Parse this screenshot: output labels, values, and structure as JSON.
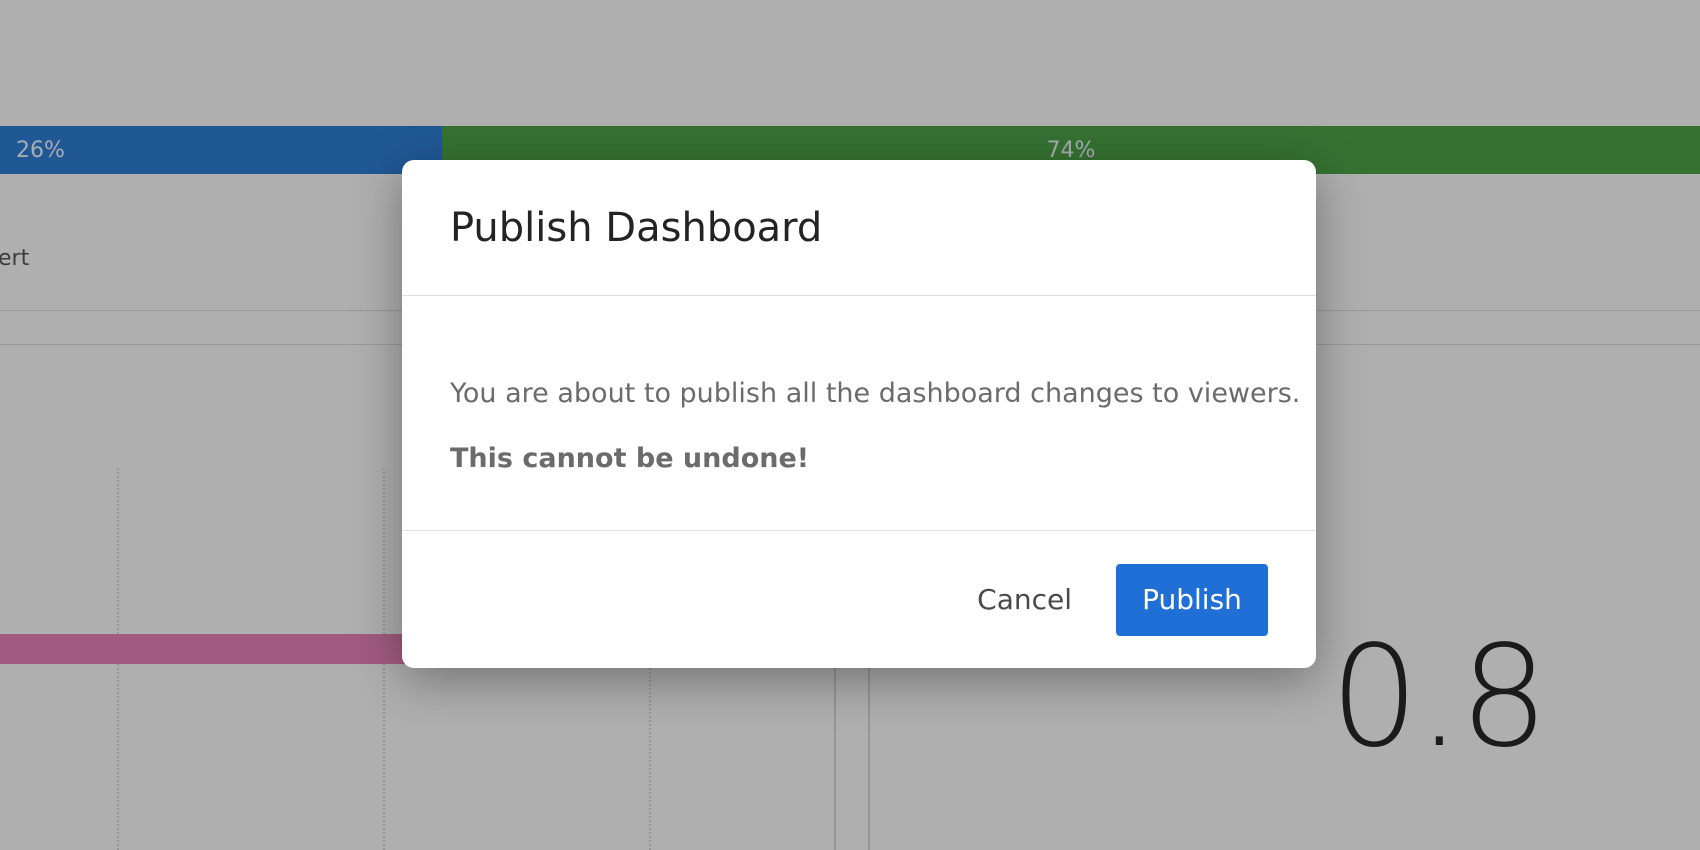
{
  "background": {
    "split_bar": {
      "segments": [
        {
          "label": "26%",
          "value": 26,
          "color": "#2d7bd0"
        },
        {
          "label": "74%",
          "value": 74,
          "color": "#4a9e46"
        }
      ]
    },
    "legend_text": "ert",
    "pink_bar_color": "#e07fb2",
    "big_number": "0.8"
  },
  "modal": {
    "title": "Publish Dashboard",
    "message": "You are about to publish all the dashboard changes to viewers.",
    "warning": "This cannot be undone!",
    "cancel_label": "Cancel",
    "publish_label": "Publish",
    "accent_color": "#1f6fd6"
  }
}
